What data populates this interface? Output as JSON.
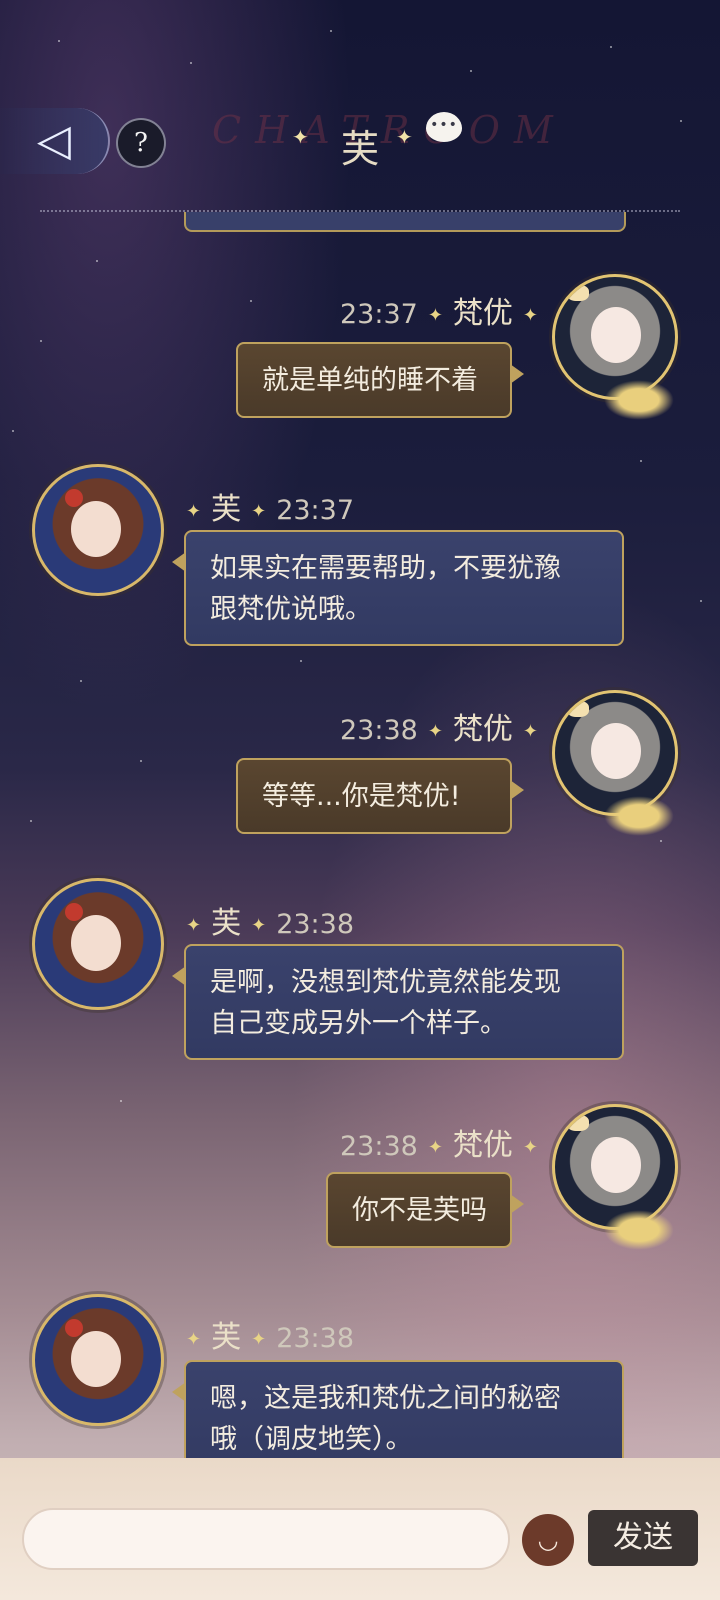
{
  "header": {
    "back_icon": "back-arrow-icon",
    "help_label": "?",
    "watermark": "CHATROOM",
    "title": "芙",
    "chat_icon_label": "•••"
  },
  "messages": [
    {
      "sender": "梵优",
      "time": "23:37",
      "side": "right",
      "text": "就是单纯的睡不着"
    },
    {
      "sender": "芙",
      "time": "23:37",
      "side": "left",
      "lines": [
        "如果实在需要帮助，不要犹豫",
        "跟梵优说哦。"
      ]
    },
    {
      "sender": "梵优",
      "time": "23:38",
      "side": "right",
      "text": "等等...你是梵优!"
    },
    {
      "sender": "芙",
      "time": "23:38",
      "side": "left",
      "lines": [
        "是啊，没想到梵优竟然能发现",
        "自己变成另外一个样子。"
      ]
    },
    {
      "sender": "梵优",
      "time": "23:38",
      "side": "right",
      "text": "你不是芙吗"
    },
    {
      "sender": "芙",
      "time": "23:38",
      "side": "left",
      "lines": [
        "嗯，这是我和梵优之间的秘密",
        "哦（调皮地笑）。"
      ]
    }
  ],
  "input": {
    "value": "",
    "placeholder": "",
    "emoji_icon": "smiley-face-icon",
    "emoji_glyph": "◡",
    "send_label": "发送"
  },
  "colors": {
    "accent_gold": "#bfa25e",
    "bubble_right": "#4a3a29",
    "bubble_left": "#323a62"
  }
}
